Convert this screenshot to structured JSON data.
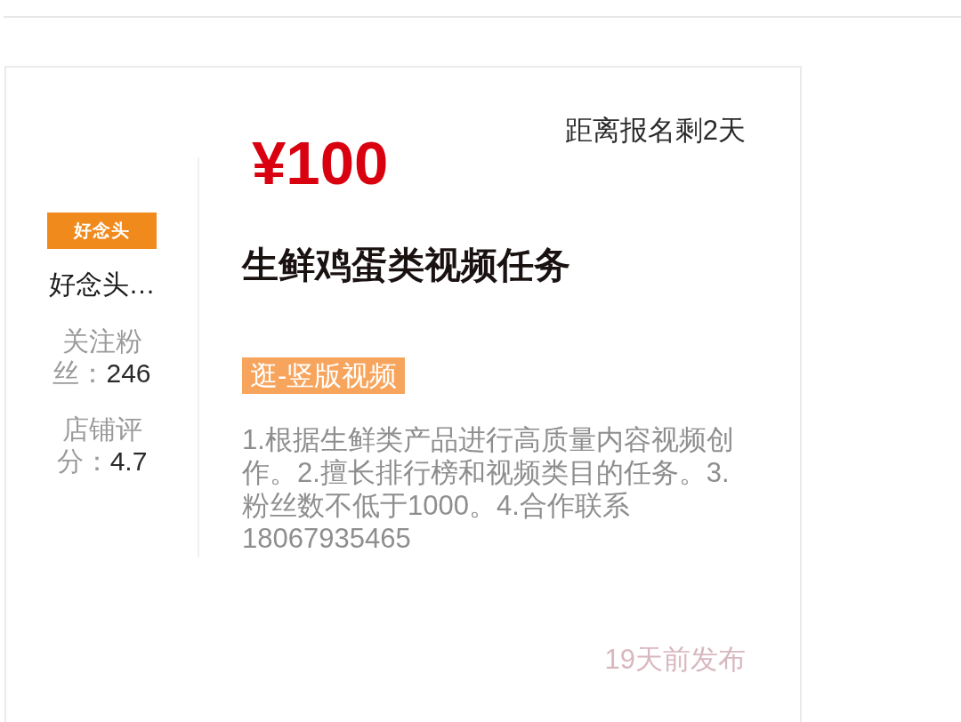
{
  "shop": {
    "logo_text": "好念头",
    "name": "好念头…",
    "stats": [
      {
        "label": "关注粉丝：",
        "value": "246"
      },
      {
        "label": "店铺评分：",
        "value": "4.7"
      }
    ]
  },
  "task": {
    "deadline": "距离报名剩2天",
    "reward": "¥100",
    "title": "生鲜鸡蛋类视频任务",
    "tags": [
      "逛-竖版视频"
    ],
    "description": "1.根据生鲜类产品进行高质量内容视频创作。2.擅长排行榜和视频类目的任务。3.粉丝数不低于1000。4.合作联系18067935465",
    "posted": "19天前发布"
  }
}
